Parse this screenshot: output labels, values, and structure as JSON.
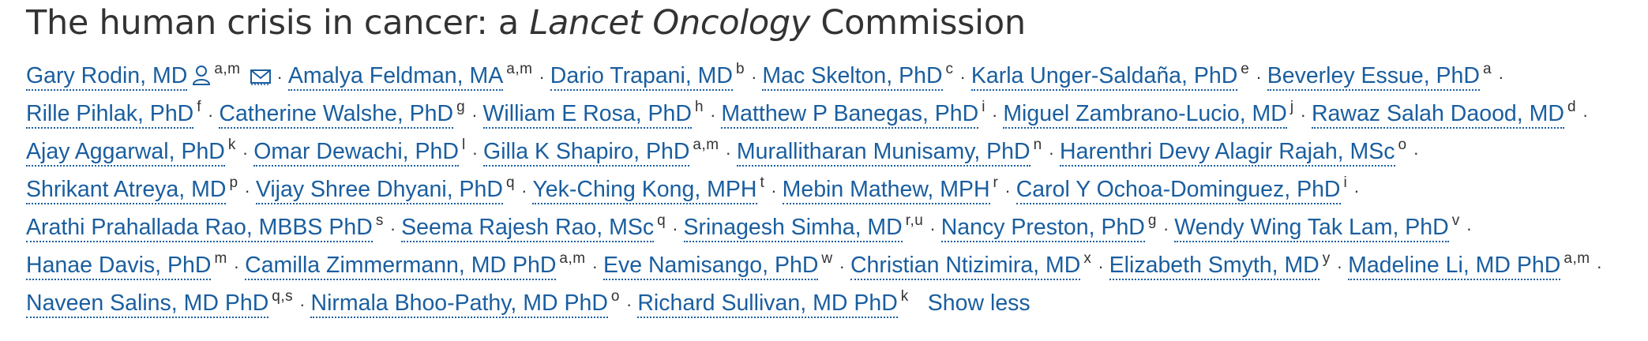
{
  "article": {
    "title_pre": "The human crisis in cancer: a ",
    "title_italic": "Lancet Oncology",
    "title_post": " Commission"
  },
  "icons": {
    "person": "person-icon",
    "email": "envelope-icon"
  },
  "colors": {
    "link": "#1a5e9f",
    "text": "#333333"
  },
  "separator": "·",
  "show_less": "Show less",
  "authors": [
    [
      {
        "name": "Gary Rodin, MD",
        "sup": "a,m",
        "icons": true
      },
      {
        "name": "Amalya Feldman, MA",
        "sup": "a,m"
      },
      {
        "name": "Dario Trapani, MD",
        "sup": "b"
      },
      {
        "name": "Mac Skelton, PhD",
        "sup": "c"
      },
      {
        "name": "Karla Unger-Saldaña, PhD",
        "sup": "e"
      },
      {
        "name": "Beverley Essue, PhD",
        "sup": "a"
      }
    ],
    [
      {
        "name": "Rille Pihlak, PhD",
        "sup": "f"
      },
      {
        "name": "Catherine Walshe, PhD",
        "sup": "g"
      },
      {
        "name": "William E Rosa, PhD",
        "sup": "h"
      },
      {
        "name": "Matthew P Banegas, PhD",
        "sup": "i"
      },
      {
        "name": "Miguel Zambrano-Lucio, MD",
        "sup": "j"
      },
      {
        "name": "Rawaz Salah Daood, MD",
        "sup": "d"
      }
    ],
    [
      {
        "name": "Ajay Aggarwal, PhD",
        "sup": "k"
      },
      {
        "name": "Omar Dewachi, PhD",
        "sup": "l"
      },
      {
        "name": "Gilla K Shapiro, PhD",
        "sup": "a,m"
      },
      {
        "name": "Murallitharan Munisamy, PhD",
        "sup": "n"
      },
      {
        "name": "Harenthri Devy Alagir Rajah, MSc",
        "sup": "o"
      }
    ],
    [
      {
        "name": "Shrikant Atreya, MD",
        "sup": "p"
      },
      {
        "name": "Vijay Shree Dhyani, PhD",
        "sup": "q"
      },
      {
        "name": "Yek-Ching Kong, MPH",
        "sup": "t"
      },
      {
        "name": "Mebin Mathew, MPH",
        "sup": "r"
      },
      {
        "name": "Carol Y Ochoa-Dominguez, PhD",
        "sup": "i"
      }
    ],
    [
      {
        "name": "Arathi Prahallada Rao, MBBS PhD",
        "sup": "s"
      },
      {
        "name": "Seema Rajesh Rao, MSc",
        "sup": "q"
      },
      {
        "name": "Srinagesh Simha, MD",
        "sup": "r,u"
      },
      {
        "name": "Nancy Preston, PhD",
        "sup": "g"
      },
      {
        "name": "Wendy Wing Tak Lam, PhD",
        "sup": "v"
      }
    ],
    [
      {
        "name": "Hanae Davis, PhD",
        "sup": "m"
      },
      {
        "name": "Camilla Zimmermann, MD PhD",
        "sup": "a,m"
      },
      {
        "name": "Eve Namisango, PhD",
        "sup": "w"
      },
      {
        "name": "Christian Ntizimira, MD",
        "sup": "x"
      },
      {
        "name": "Elizabeth Smyth, MD",
        "sup": "y"
      },
      {
        "name": "Madeline Li, MD PhD",
        "sup": "a,m"
      }
    ],
    [
      {
        "name": "Naveen Salins, MD PhD",
        "sup": "q,s"
      },
      {
        "name": "Nirmala Bhoo-Pathy, MD PhD",
        "sup": "o"
      },
      {
        "name": "Richard Sullivan, MD PhD",
        "sup": "k"
      }
    ]
  ]
}
